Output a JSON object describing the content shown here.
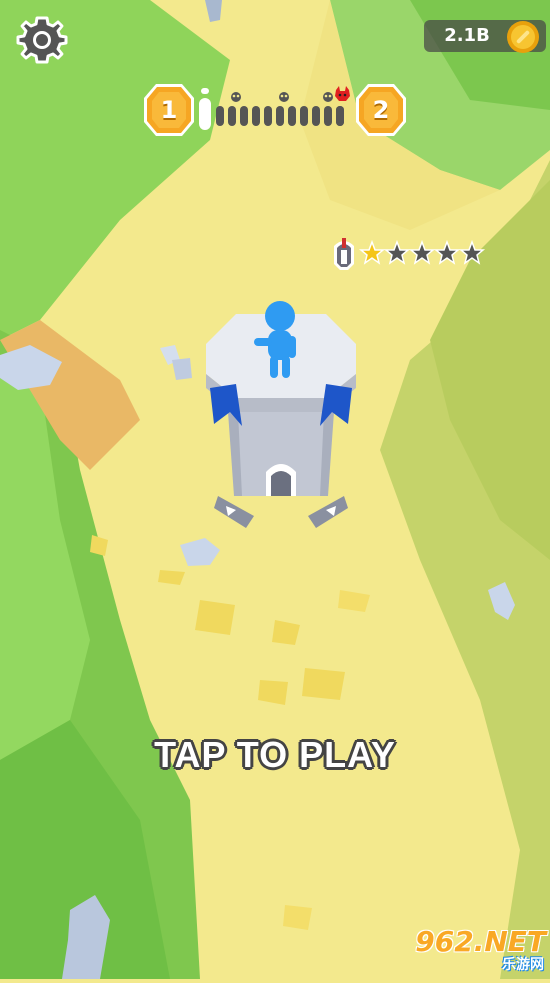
{
  "hud": {
    "coins": "2.1B",
    "current_level": "1",
    "next_level": "2",
    "stage_progress": {
      "current_position": 1,
      "steps": [
        "player",
        "enemy",
        "enemy",
        "enemy",
        "enemy",
        "enemy",
        "enemy",
        "enemy",
        "enemy",
        "enemy",
        "enemy",
        "boss"
      ]
    }
  },
  "tower": {
    "stars_filled": 1,
    "stars_total": 5
  },
  "prompt": {
    "tap_to_play": "TAP TO PLAY"
  },
  "watermark": {
    "main": "962.NET",
    "sub": "乐游网"
  },
  "colors": {
    "grass": "#8fd45a",
    "path": "#f3e98d",
    "badge": "#f6a623",
    "star": "#f5c518",
    "player": "#2f9bf2",
    "flag": "#1e56c9"
  },
  "icons": {
    "settings": "gear-icon",
    "coin": "coin-icon",
    "level": "level-shield-icon",
    "boss": "devil-icon",
    "tower": "helmet-icon",
    "star": "star-icon"
  }
}
